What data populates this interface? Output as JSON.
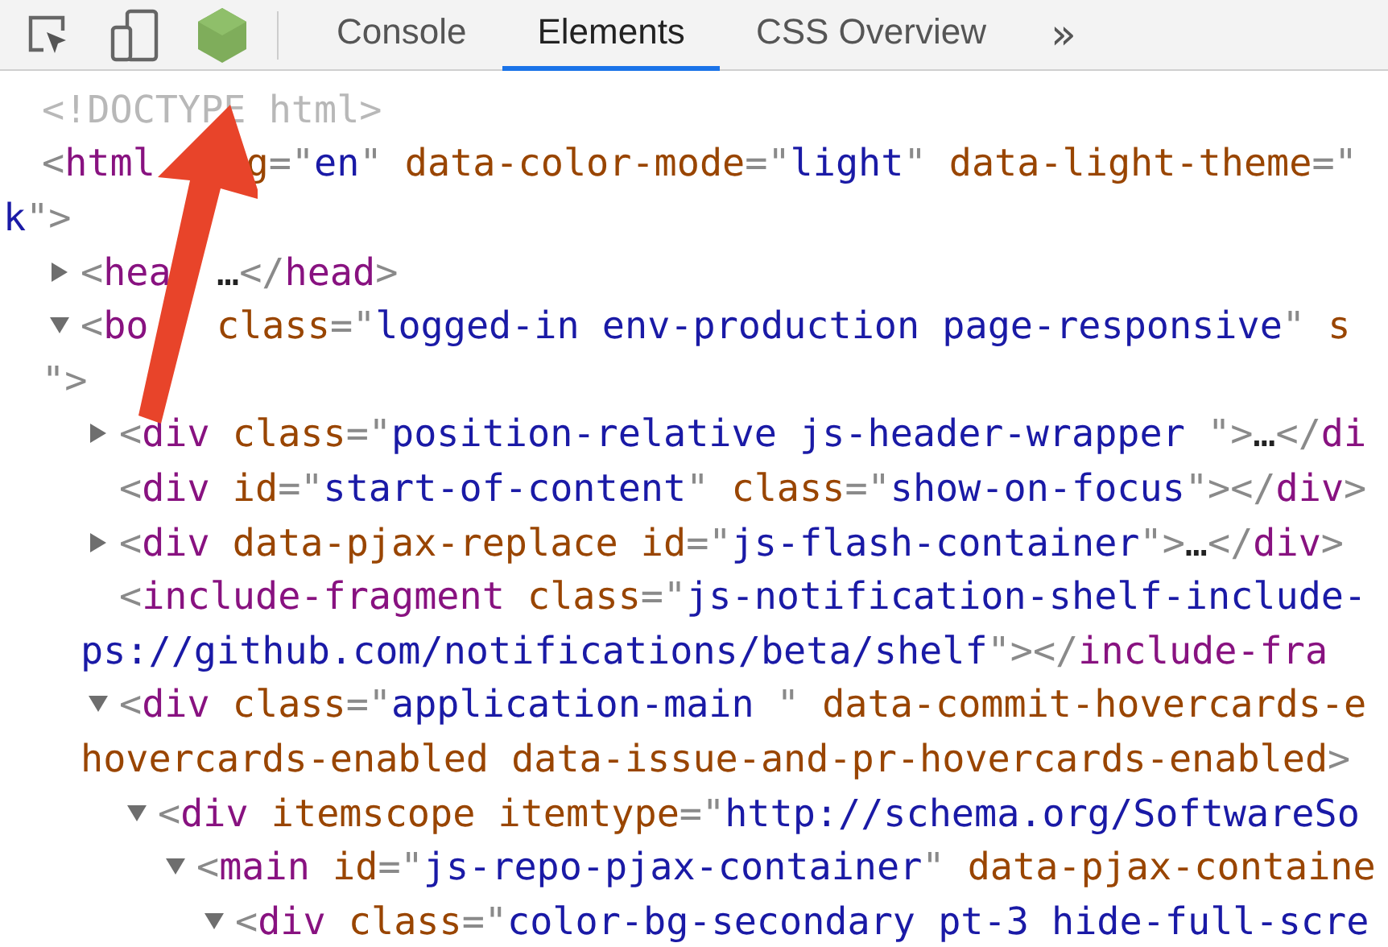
{
  "tabs": [
    {
      "label": "Console",
      "selected": false
    },
    {
      "label": "Elements",
      "selected": true
    },
    {
      "label": "CSS Overview",
      "selected": false
    }
  ],
  "more_tabs": "»",
  "dom_tree": [
    {
      "lines": [
        [
          {
            "kind": "doctype",
            "text": "<!DOCTYPE html>"
          }
        ]
      ]
    },
    {
      "lines": [
        [
          {
            "kind": "punct",
            "text": "<"
          },
          {
            "kind": "tag",
            "text": "html"
          },
          {
            "kind": "attr",
            "text": "    g"
          },
          {
            "kind": "punct",
            "text": "=\""
          },
          {
            "kind": "value",
            "text": "en"
          },
          {
            "kind": "punct",
            "text": "\""
          },
          {
            "kind": "attr",
            "text": " data-color-mode"
          },
          {
            "kind": "punct",
            "text": "=\""
          },
          {
            "kind": "value",
            "text": "light"
          },
          {
            "kind": "punct",
            "text": "\""
          },
          {
            "kind": "attr",
            "text": " data-light-theme"
          },
          {
            "kind": "punct",
            "text": "=\""
          }
        ],
        [
          {
            "kind": "value",
            "text": "k"
          },
          {
            "kind": "punct",
            "text": "\">"
          }
        ]
      ],
      "children": [
        {
          "expanded": false,
          "lines": [
            [
              {
                "kind": "punct",
                "text": "<"
              },
              {
                "kind": "tag",
                "text": "hea"
              },
              {
                "kind": "ellipsis",
                "text": "  …"
              },
              {
                "kind": "punct",
                "text": "</"
              },
              {
                "kind": "tag",
                "text": "head"
              },
              {
                "kind": "punct",
                "text": ">"
              }
            ]
          ]
        },
        {
          "expanded": true,
          "lines": [
            [
              {
                "kind": "punct",
                "text": "<"
              },
              {
                "kind": "tag",
                "text": "bo"
              },
              {
                "kind": "attr",
                "text": "   class"
              },
              {
                "kind": "punct",
                "text": "=\""
              },
              {
                "kind": "value",
                "text": "logged-in env-production page-responsive"
              },
              {
                "kind": "punct",
                "text": "\""
              },
              {
                "kind": "attr",
                "text": " s"
              }
            ],
            [
              {
                "kind": "punct",
                "text": "\">"
              }
            ]
          ],
          "children": [
            {
              "expanded": false,
              "lines": [
                [
                  {
                    "kind": "punct",
                    "text": "<"
                  },
                  {
                    "kind": "tag",
                    "text": "div"
                  },
                  {
                    "kind": "attr",
                    "text": " class"
                  },
                  {
                    "kind": "punct",
                    "text": "=\""
                  },
                  {
                    "kind": "value",
                    "text": "position-relative js-header-wrapper "
                  },
                  {
                    "kind": "punct",
                    "text": "\">"
                  },
                  {
                    "kind": "ellipsis",
                    "text": "…"
                  },
                  {
                    "kind": "punct",
                    "text": "</"
                  },
                  {
                    "kind": "tag",
                    "text": "di"
                  }
                ]
              ]
            },
            {
              "lines": [
                [
                  {
                    "kind": "punct",
                    "text": "<"
                  },
                  {
                    "kind": "tag",
                    "text": "div"
                  },
                  {
                    "kind": "attr",
                    "text": " id"
                  },
                  {
                    "kind": "punct",
                    "text": "=\""
                  },
                  {
                    "kind": "value",
                    "text": "start-of-content"
                  },
                  {
                    "kind": "punct",
                    "text": "\""
                  },
                  {
                    "kind": "attr",
                    "text": " class"
                  },
                  {
                    "kind": "punct",
                    "text": "=\""
                  },
                  {
                    "kind": "value",
                    "text": "show-on-focus"
                  },
                  {
                    "kind": "punct",
                    "text": "\"></"
                  },
                  {
                    "kind": "tag",
                    "text": "div"
                  },
                  {
                    "kind": "punct",
                    "text": ">"
                  }
                ]
              ]
            },
            {
              "expanded": false,
              "lines": [
                [
                  {
                    "kind": "punct",
                    "text": "<"
                  },
                  {
                    "kind": "tag",
                    "text": "div"
                  },
                  {
                    "kind": "attr",
                    "text": " data-pjax-replace id"
                  },
                  {
                    "kind": "punct",
                    "text": "=\""
                  },
                  {
                    "kind": "value",
                    "text": "js-flash-container"
                  },
                  {
                    "kind": "punct",
                    "text": "\">"
                  },
                  {
                    "kind": "ellipsis",
                    "text": "…"
                  },
                  {
                    "kind": "punct",
                    "text": "</"
                  },
                  {
                    "kind": "tag",
                    "text": "div"
                  },
                  {
                    "kind": "punct",
                    "text": ">"
                  }
                ]
              ]
            },
            {
              "lines": [
                [
                  {
                    "kind": "punct",
                    "text": "<"
                  },
                  {
                    "kind": "tag",
                    "text": "include-fragment"
                  },
                  {
                    "kind": "attr",
                    "text": " class"
                  },
                  {
                    "kind": "punct",
                    "text": "=\""
                  },
                  {
                    "kind": "value",
                    "text": "js-notification-shelf-include-"
                  }
                ],
                [
                  {
                    "kind": "value",
                    "text": "ps://github.com/notifications/beta/shelf"
                  },
                  {
                    "kind": "punct",
                    "text": "\"></"
                  },
                  {
                    "kind": "tag",
                    "text": "include-fra"
                  }
                ]
              ]
            },
            {
              "expanded": true,
              "lines": [
                [
                  {
                    "kind": "punct",
                    "text": "<"
                  },
                  {
                    "kind": "tag",
                    "text": "div"
                  },
                  {
                    "kind": "attr",
                    "text": " class"
                  },
                  {
                    "kind": "punct",
                    "text": "=\""
                  },
                  {
                    "kind": "value",
                    "text": "application-main "
                  },
                  {
                    "kind": "punct",
                    "text": "\""
                  },
                  {
                    "kind": "attr",
                    "text": " data-commit-hovercards-e"
                  }
                ],
                [
                  {
                    "kind": "attr",
                    "text": "hovercards-enabled data-issue-and-pr-hovercards-enabled"
                  },
                  {
                    "kind": "punct",
                    "text": ">"
                  }
                ]
              ],
              "children": [
                {
                  "expanded": true,
                  "lines": [
                    [
                      {
                        "kind": "punct",
                        "text": "<"
                      },
                      {
                        "kind": "tag",
                        "text": "div"
                      },
                      {
                        "kind": "attr",
                        "text": " itemscope itemtype"
                      },
                      {
                        "kind": "punct",
                        "text": "=\""
                      },
                      {
                        "kind": "value",
                        "text": "http://schema.org/SoftwareSo"
                      }
                    ]
                  ],
                  "children": [
                    {
                      "expanded": true,
                      "lines": [
                        [
                          {
                            "kind": "punct",
                            "text": "<"
                          },
                          {
                            "kind": "tag",
                            "text": "main"
                          },
                          {
                            "kind": "attr",
                            "text": " id"
                          },
                          {
                            "kind": "punct",
                            "text": "=\""
                          },
                          {
                            "kind": "value",
                            "text": "js-repo-pjax-container"
                          },
                          {
                            "kind": "punct",
                            "text": "\""
                          },
                          {
                            "kind": "attr",
                            "text": " data-pjax-containe"
                          }
                        ]
                      ],
                      "children": [
                        {
                          "expanded": true,
                          "lines": [
                            [
                              {
                                "kind": "punct",
                                "text": "<"
                              },
                              {
                                "kind": "tag",
                                "text": "div"
                              },
                              {
                                "kind": "attr",
                                "text": " class"
                              },
                              {
                                "kind": "punct",
                                "text": "=\""
                              },
                              {
                                "kind": "value",
                                "text": "color-bg-secondary pt-3 hide-full-scre"
                              }
                            ]
                          ]
                        }
                      ]
                    }
                  ]
                }
              ]
            }
          ]
        }
      ]
    }
  ]
}
